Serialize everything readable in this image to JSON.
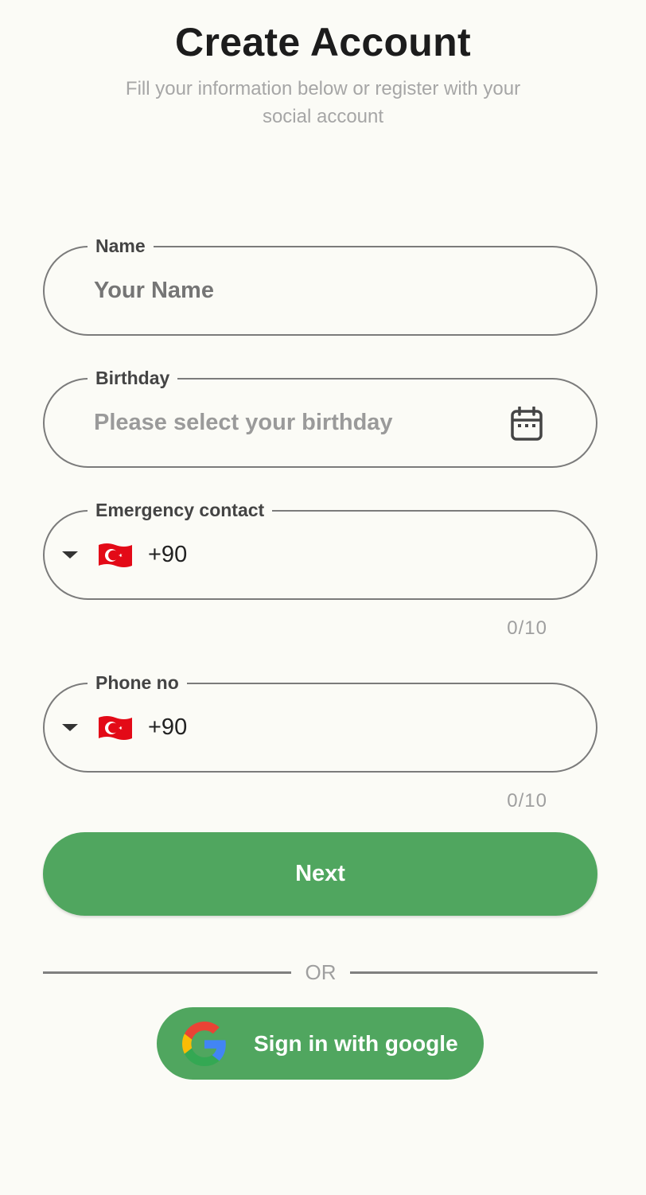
{
  "header": {
    "title": "Create Account",
    "subtitle": "Fill your information below or register with your social account"
  },
  "form": {
    "name": {
      "label": "Name",
      "placeholder": "Your Name",
      "value": ""
    },
    "birthday": {
      "label": "Birthday",
      "placeholder": "Please select your birthday",
      "icon": "calendar-icon"
    },
    "emergency_contact": {
      "label": "Emergency contact",
      "country_flag": "turkey-flag",
      "dial_code": "+90",
      "counter": "0/10"
    },
    "phone": {
      "label": "Phone no",
      "country_flag": "turkey-flag",
      "dial_code": "+90",
      "counter": "0/10"
    }
  },
  "actions": {
    "next_label": "Next",
    "or_label": "OR",
    "google_label": "Sign in with google"
  },
  "colors": {
    "background": "#fbfbf6",
    "primary_green": "#50a65f",
    "outline": "#7b7b7b",
    "placeholder": "#9a9a9a",
    "flag_red": "#e30a17"
  }
}
